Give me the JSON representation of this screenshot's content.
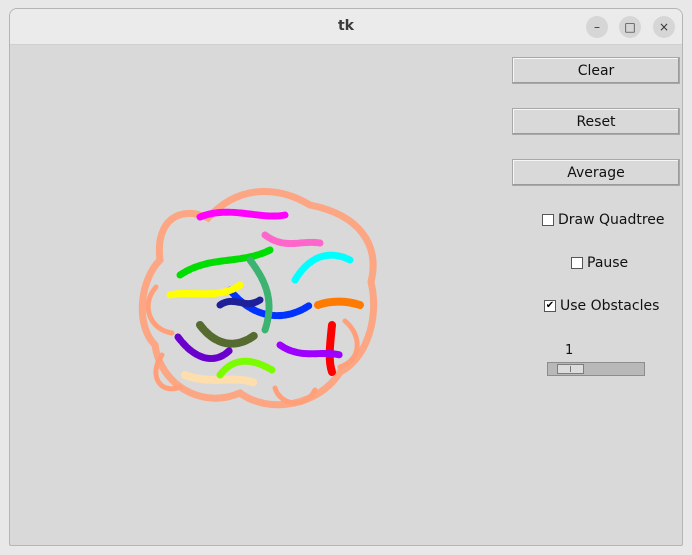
{
  "window": {
    "title": "tk",
    "controls": {
      "minimize_icon": "minimize-icon",
      "maximize_icon": "maximize-icon",
      "close_icon": "close-icon"
    }
  },
  "buttons": {
    "clear": "Clear",
    "reset": "Reset",
    "average": "Average"
  },
  "checkboxes": [
    {
      "label": "Draw Quadtree",
      "checked": false
    },
    {
      "label": "Pause",
      "checked": false
    },
    {
      "label": "Use Obstacles",
      "checked": true
    }
  ],
  "scale": {
    "value": "1",
    "min": 1,
    "max": 10
  },
  "colors": {
    "background": "#d9d9d9",
    "trail_outer": "#ffa07a",
    "trail_palette": [
      "#ff00ff",
      "#00ff00",
      "#0000ff",
      "#ffff00",
      "#00ffff",
      "#ff0000",
      "#556b2f",
      "#7b2cbf",
      "#ffdead",
      "#3cb371"
    ]
  }
}
